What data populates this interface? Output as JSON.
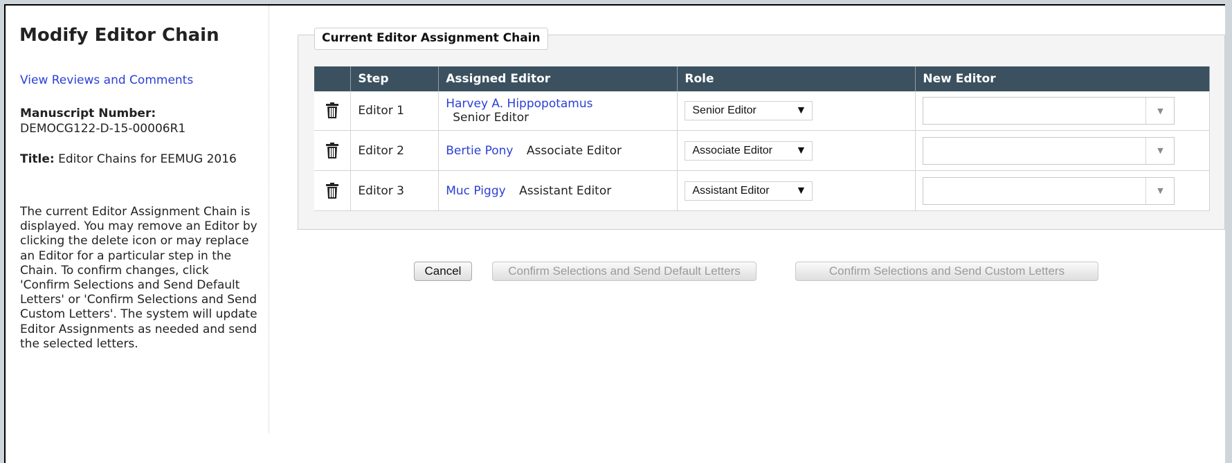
{
  "sidebar": {
    "page_title": "Modify Editor Chain",
    "view_link": "View Reviews and Comments",
    "manuscript_label": "Manuscript Number:",
    "manuscript_number": "DEMOCG122-D-15-00006R1",
    "title_label": "Title:",
    "title_value": "Editor Chains for EEMUG 2016",
    "help_text": "The current Editor Assignment Chain is displayed. You may remove an Editor by clicking the delete icon or may replace an Editor for a particular step in the Chain. To confirm changes, click 'Confirm Selections and Send Default Letters' or 'Confirm Selections and Send Custom Letters'. The system will update Editor Assignments as needed and send the selected letters."
  },
  "chain": {
    "legend": "Current Editor Assignment Chain",
    "columns": [
      "",
      "Step",
      "Assigned Editor",
      "Role",
      "New Editor"
    ],
    "rows": [
      {
        "step": "Editor 1",
        "editor_name": "Harvey A. Hippopotamus",
        "editor_role": "Senior Editor",
        "role_value": "Senior Editor",
        "new_editor": ""
      },
      {
        "step": "Editor 2",
        "editor_name": "Bertie Pony",
        "editor_role": "Associate Editor",
        "role_value": "Associate Editor",
        "new_editor": ""
      },
      {
        "step": "Editor 3",
        "editor_name": "Muc Piggy",
        "editor_role": "Assistant Editor",
        "role_value": "Assistant Editor",
        "new_editor": ""
      }
    ],
    "icons": {
      "delete": "trash-icon",
      "select_arrow": "chevron-down-icon"
    }
  },
  "buttons": {
    "cancel": "Cancel",
    "confirm_default": "Confirm Selections and Send Default Letters",
    "confirm_custom": "Confirm Selections and Send Custom Letters"
  },
  "colors": {
    "header_bg": "#3b5160",
    "link": "#2a3fd6",
    "disabled_text": "#9a9a9a"
  }
}
